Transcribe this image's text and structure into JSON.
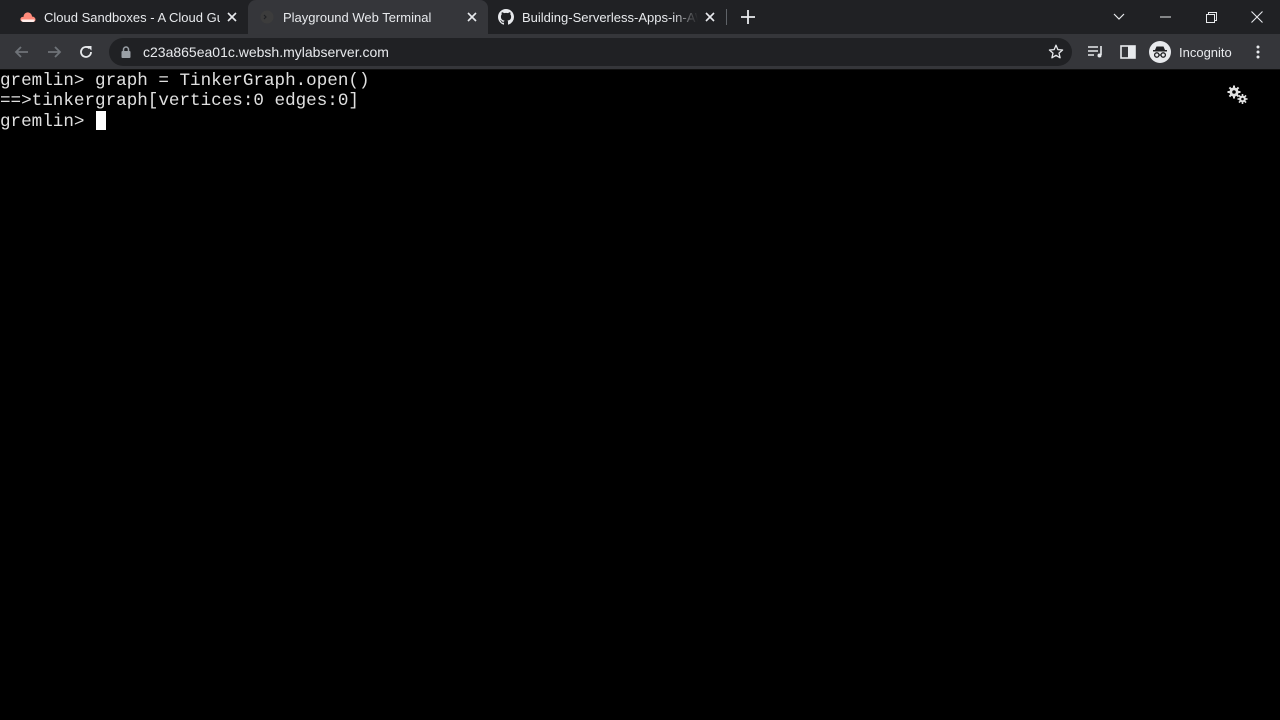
{
  "browser": {
    "tabs": [
      {
        "title": "Cloud Sandboxes - A Cloud Guru",
        "icon": "cloud-guru-icon",
        "active": false
      },
      {
        "title": "Playground Web Terminal",
        "icon": "terminal-globe-icon",
        "active": true
      },
      {
        "title": "Building-Serverless-Apps-in-AWS",
        "icon": "github-icon",
        "active": false
      }
    ],
    "url": "c23a865ea01c.websh.mylabserver.com",
    "profile_label": "Incognito"
  },
  "terminal": {
    "lines": [
      "gremlin> graph = TinkerGraph.open()",
      "==>tinkergraph[vertices:0 edges:0]",
      "gremlin> "
    ]
  },
  "colors": {
    "tabstrip_bg": "#202124",
    "toolbar_bg": "#35363a",
    "terminal_bg": "#000000",
    "terminal_fg": "#e0e0e0"
  }
}
